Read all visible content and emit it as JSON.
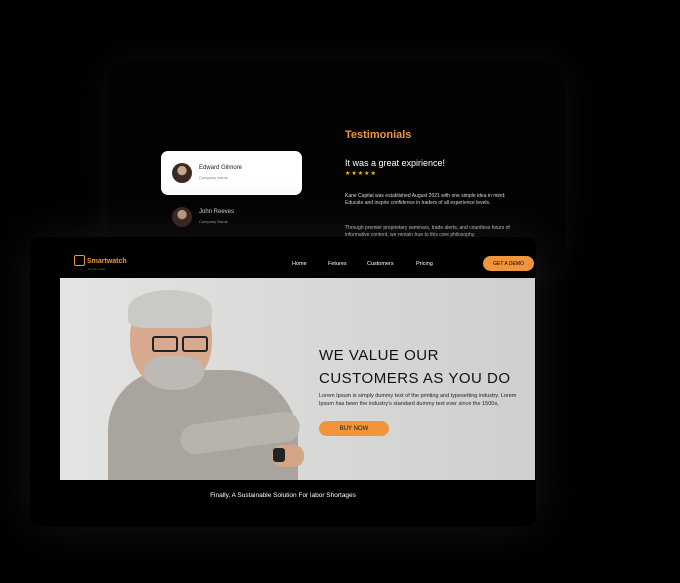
{
  "testimonials": {
    "heading": "Testimonials",
    "people": [
      {
        "name": "Edward Gilmore",
        "company": "Company Name"
      },
      {
        "name": "John Reeves",
        "company": "Company Name"
      }
    ],
    "quote_title": "It was a great expirience!",
    "stars": "★★★★★",
    "paragraphs": [
      "Kane Capital was established August 2021 with one simple idea in mind: Educate and inspire confidence in traders of all experience levels.",
      "Through premier proprietary seminars, trade alerts, and countless hours of informative content, we remain true to this core philosophy."
    ]
  },
  "nav": {
    "logo_text": "Smartwatch",
    "logo_sub": "for the smart",
    "links": [
      "Home",
      "Fetures",
      "Customers",
      "Pricing"
    ],
    "demo_label": "GET A DEMO"
  },
  "hero": {
    "title_line1": "WE VALUE OUR",
    "title_line2": "CUSTOMERS AS YOU DO",
    "text": "Lorem Ipsum is simply dummy text of the printing and typesetting industry. Lorem Ipsum has been the industry's standard dummy text ever since the 1500s,",
    "buy_label": "BUY NOW"
  },
  "footer": {
    "tagline": "Finally, A Sustainable Solution For labor Shortages"
  },
  "colors": {
    "accent": "#f0953a",
    "background": "#000000",
    "star": "#f5c200"
  }
}
